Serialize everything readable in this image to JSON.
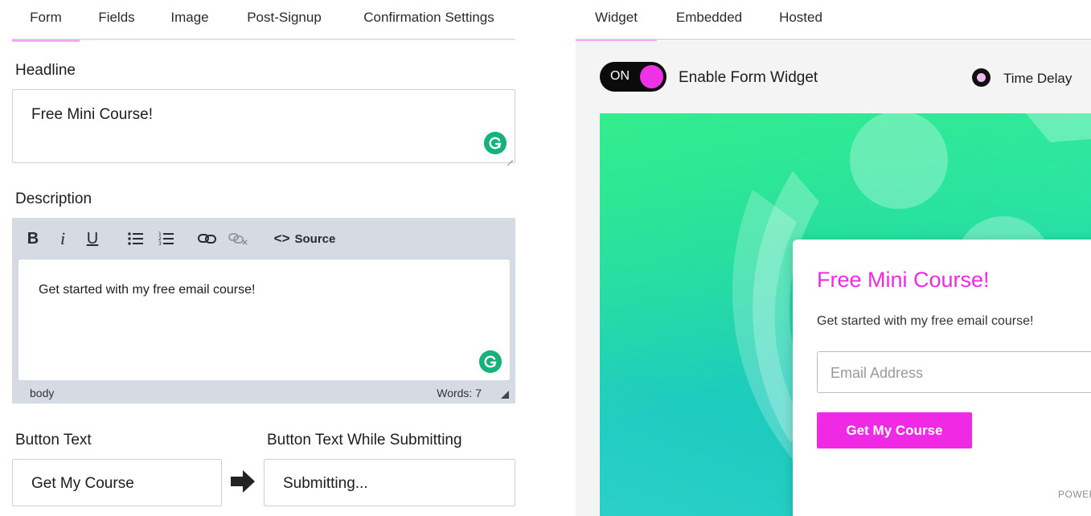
{
  "left": {
    "tabs": [
      {
        "label": "Form",
        "active": true
      },
      {
        "label": "Fields",
        "active": false
      },
      {
        "label": "Image",
        "active": false
      },
      {
        "label": "Post-Signup",
        "active": false
      },
      {
        "label": "Confirmation Settings",
        "active": false
      }
    ],
    "headline": {
      "label": "Headline",
      "value": "Free Mini Course!"
    },
    "description": {
      "label": "Description",
      "toolbar": {
        "bold": "B",
        "italic": "i",
        "underline": "U",
        "source_chevrons": "<>",
        "source_label": "Source"
      },
      "content": "Get started with my free email course!",
      "status_path": "body",
      "status_words": "Words: 7"
    },
    "button_text": {
      "label": "Button Text",
      "value": "Get My Course"
    },
    "button_submitting": {
      "label": "Button Text While Submitting",
      "value": "Submitting..."
    }
  },
  "right": {
    "tabs": [
      {
        "label": "Widget",
        "active": true
      },
      {
        "label": "Embedded",
        "active": false
      },
      {
        "label": "Hosted",
        "active": false
      }
    ],
    "toggle": {
      "state_label": "ON",
      "on": true
    },
    "enable_label": "Enable Form Widget",
    "time_delay_label": "Time Delay",
    "preview": {
      "title": "Free Mini Course!",
      "description": "Get started with my free email course!",
      "email_placeholder": "Email Address",
      "button": "Get My Course",
      "powered": "POWER"
    }
  },
  "colors": {
    "accent_pink": "#f02ae4",
    "tab_underline": "#f2a8f2",
    "grammarly_green": "#15b37a",
    "editor_gray": "#d5dae3",
    "preview_green": "#2ee6a6",
    "preview_teal": "#1ecbbf"
  },
  "icons": [
    "grammarly-icon",
    "bullet-list-icon",
    "numbered-list-icon",
    "link-icon",
    "unlink-icon",
    "right-arrow-icon",
    "resize-handle-icon"
  ]
}
